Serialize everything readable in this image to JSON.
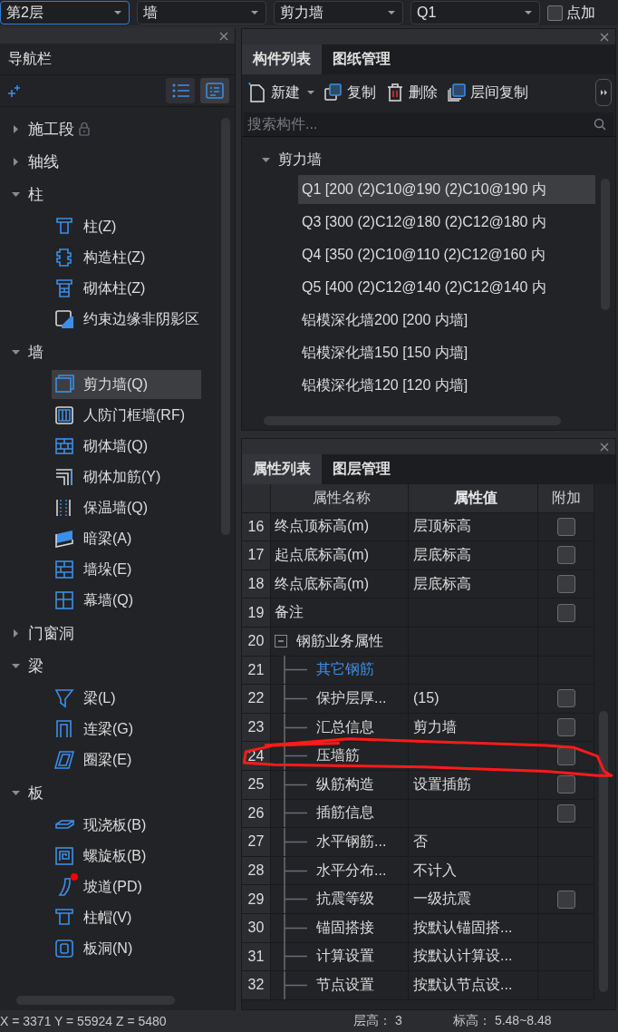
{
  "toolbar": {
    "dropdowns": [
      {
        "value": "第2层",
        "focused": true
      },
      {
        "value": "墙",
        "focused": false
      },
      {
        "value": "剪力墙",
        "focused": false
      },
      {
        "value": "Q1",
        "focused": false
      }
    ],
    "option": {
      "label": "点加",
      "checked": false
    }
  },
  "navigation": {
    "title": "导航栏",
    "views": [
      {
        "selected": false
      },
      {
        "selected": true
      }
    ],
    "items": [
      {
        "label": "施工段",
        "expanded": false,
        "locked": true
      },
      {
        "label": "轴线",
        "expanded": false,
        "locked": false
      },
      {
        "label": "柱",
        "expanded": true,
        "locked": false,
        "children": [
          {
            "label": "柱(Z)",
            "selected": false,
            "marked": false
          },
          {
            "label": "构造柱(Z)",
            "selected": false,
            "marked": false
          },
          {
            "label": "砌体柱(Z)",
            "selected": false,
            "marked": false
          },
          {
            "label": "约束边缘非阴影区",
            "selected": false,
            "marked": false
          }
        ]
      },
      {
        "label": "墙",
        "expanded": true,
        "locked": false,
        "children": [
          {
            "label": "剪力墙(Q)",
            "selected": true,
            "marked": false
          },
          {
            "label": "人防门框墙(RF)",
            "selected": false,
            "marked": false
          },
          {
            "label": "砌体墙(Q)",
            "selected": false,
            "marked": false
          },
          {
            "label": "砌体加筋(Y)",
            "selected": false,
            "marked": false
          },
          {
            "label": "保温墙(Q)",
            "selected": false,
            "marked": false
          },
          {
            "label": "暗梁(A)",
            "selected": false,
            "marked": false
          },
          {
            "label": "墙垛(E)",
            "selected": false,
            "marked": false
          },
          {
            "label": "幕墙(Q)",
            "selected": false,
            "marked": false
          }
        ]
      },
      {
        "label": "门窗洞",
        "expanded": false,
        "locked": false
      },
      {
        "label": "梁",
        "expanded": true,
        "locked": false,
        "children": [
          {
            "label": "梁(L)",
            "selected": false,
            "marked": false
          },
          {
            "label": "连梁(G)",
            "selected": false,
            "marked": false
          },
          {
            "label": "圈梁(E)",
            "selected": false,
            "marked": false
          }
        ]
      },
      {
        "label": "板",
        "expanded": true,
        "locked": false,
        "children": [
          {
            "label": "现浇板(B)",
            "selected": false,
            "marked": false
          },
          {
            "label": "螺旋板(B)",
            "selected": false,
            "marked": false
          },
          {
            "label": "坡道(PD)",
            "selected": false,
            "marked": true
          },
          {
            "label": "柱帽(V)",
            "selected": false,
            "marked": false
          },
          {
            "label": "板洞(N)",
            "selected": false,
            "marked": false
          }
        ]
      }
    ]
  },
  "components": {
    "tabs": [
      {
        "label": "构件列表",
        "selected": true
      },
      {
        "label": "图纸管理",
        "selected": false
      }
    ],
    "actions": [
      {
        "label": "新建",
        "kind": "new"
      },
      {
        "label": "复制",
        "kind": "copy"
      },
      {
        "label": "删除",
        "kind": "delete"
      },
      {
        "label": "层间复制",
        "kind": "floorcopy"
      }
    ],
    "search": {
      "placeholder": "搜索构件..."
    },
    "tree": [
      {
        "label": "剪力墙",
        "expanded": true,
        "children": [
          {
            "label": "Q1 [200 (2)C10@190 (2)C10@190 内",
            "selected": true
          },
          {
            "label": "Q3 [300 (2)C12@180 (2)C12@180 内",
            "selected": false
          },
          {
            "label": "Q4 [350 (2)C10@110 (2)C12@160 内",
            "selected": false
          },
          {
            "label": "Q5 [400 (2)C12@140 (2)C12@140 内",
            "selected": false
          },
          {
            "label": "铝模深化墙200 [200 内墙]",
            "selected": false
          },
          {
            "label": "铝模深化墙150 [150 内墙]",
            "selected": false
          },
          {
            "label": "铝模深化墙120 [120 内墙]",
            "selected": false
          }
        ]
      }
    ]
  },
  "properties": {
    "tabs": [
      {
        "label": "属性列表",
        "selected": true
      },
      {
        "label": "图层管理",
        "selected": false
      }
    ],
    "columns": [
      "属性名称",
      "属性值",
      "附加"
    ],
    "rows": [
      {
        "num": "16",
        "name": "终点顶标高(m)",
        "value": "层顶标高",
        "checked": false,
        "circled": false
      },
      {
        "num": "17",
        "name": "起点底标高(m)",
        "value": "层底标高",
        "checked": false,
        "circled": false
      },
      {
        "num": "18",
        "name": "终点底标高(m)",
        "value": "层底标高",
        "checked": false,
        "circled": false
      },
      {
        "num": "19",
        "name": "备注",
        "checked": false,
        "circled": false
      },
      {
        "num": "20",
        "name": "钢筋业务属性",
        "expanded": true,
        "circled": false,
        "children": [
          {
            "num": "21",
            "name": "其它钢筋",
            "kind": "link",
            "circled": false
          },
          {
            "num": "22",
            "name": "保护层厚...",
            "value": "(15)",
            "checked": false,
            "circled": false
          },
          {
            "num": "23",
            "name": "汇总信息",
            "value": "剪力墙",
            "checked": false,
            "circled": false
          },
          {
            "num": "24",
            "name": "压墙筋",
            "checked": false,
            "circled": true
          },
          {
            "num": "25",
            "name": "纵筋构造",
            "value": "设置插筋",
            "checked": false,
            "circled": false
          },
          {
            "num": "26",
            "name": "插筋信息",
            "checked": false,
            "circled": false
          },
          {
            "num": "27",
            "name": "水平钢筋...",
            "value": "否",
            "circled": false
          },
          {
            "num": "28",
            "name": "水平分布...",
            "value": "不计入",
            "circled": false
          },
          {
            "num": "29",
            "name": "抗震等级",
            "value": "一级抗震",
            "checked": false,
            "circled": false
          },
          {
            "num": "30",
            "name": "锚固搭接",
            "value": "按默认锚固搭...",
            "circled": false
          },
          {
            "num": "31",
            "name": "计算设置",
            "value": "按默认计算设...",
            "circled": false
          },
          {
            "num": "32",
            "name": "节点设置",
            "value": "按默认节点设...",
            "circled": false
          }
        ]
      }
    ]
  },
  "status_bar": {
    "coordinates": "X = 3371 Y = 55924 Z = 5480",
    "floor_height": "层高： 3",
    "elevation": "标高： 5.48~8.48"
  }
}
